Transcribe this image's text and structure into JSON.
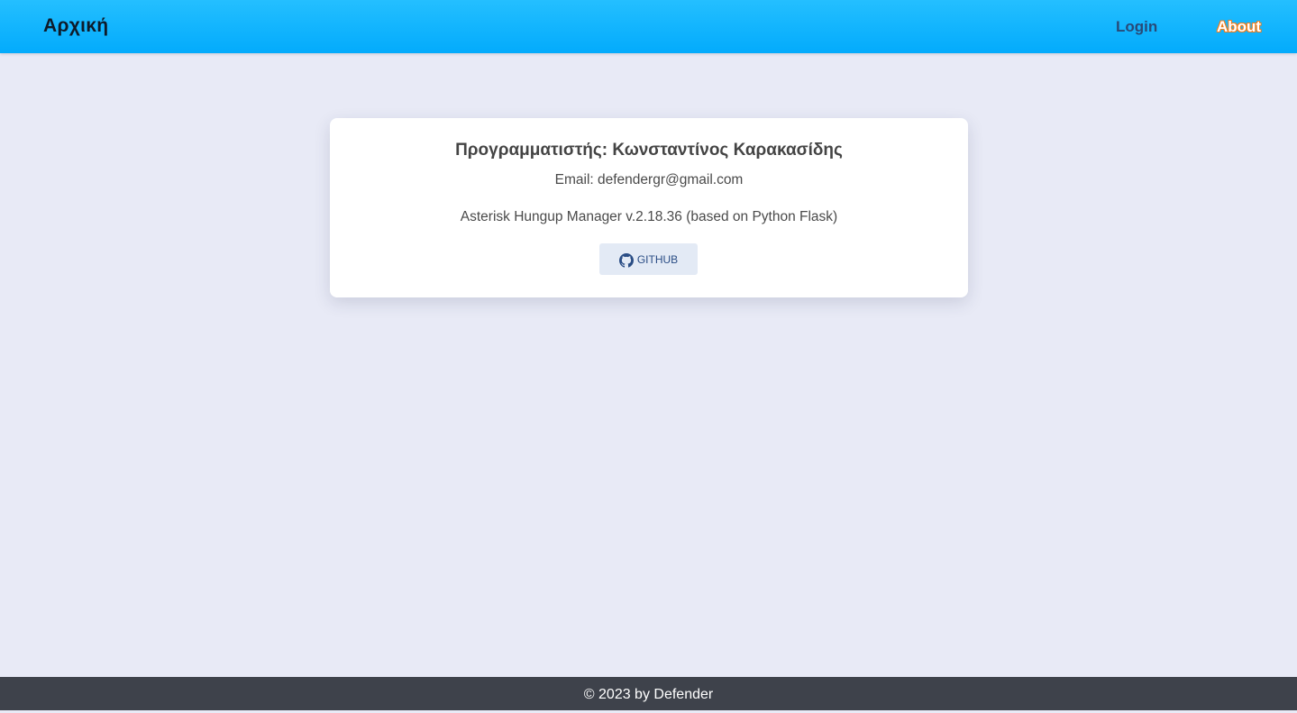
{
  "navbar": {
    "brand": "Αρχική",
    "links": [
      {
        "label": "Login"
      },
      {
        "label": "About"
      }
    ]
  },
  "about_card": {
    "programmer": "Προγραμματιστής: Κωνσταντίνος Καρακασίδης",
    "email": "Email: defendergr@gmail.com",
    "version": "Asterisk Hungup Manager v.2.18.36 (based on Python Flask)",
    "github_label": "GITHUB",
    "github_icon": "github-icon"
  },
  "footer": {
    "text": "© 2023 by Defender"
  },
  "colors": {
    "navbar": "#03abfc",
    "background": "#e8eaf6",
    "footer": "#3e424b",
    "about_outline": "#f07c1a"
  }
}
